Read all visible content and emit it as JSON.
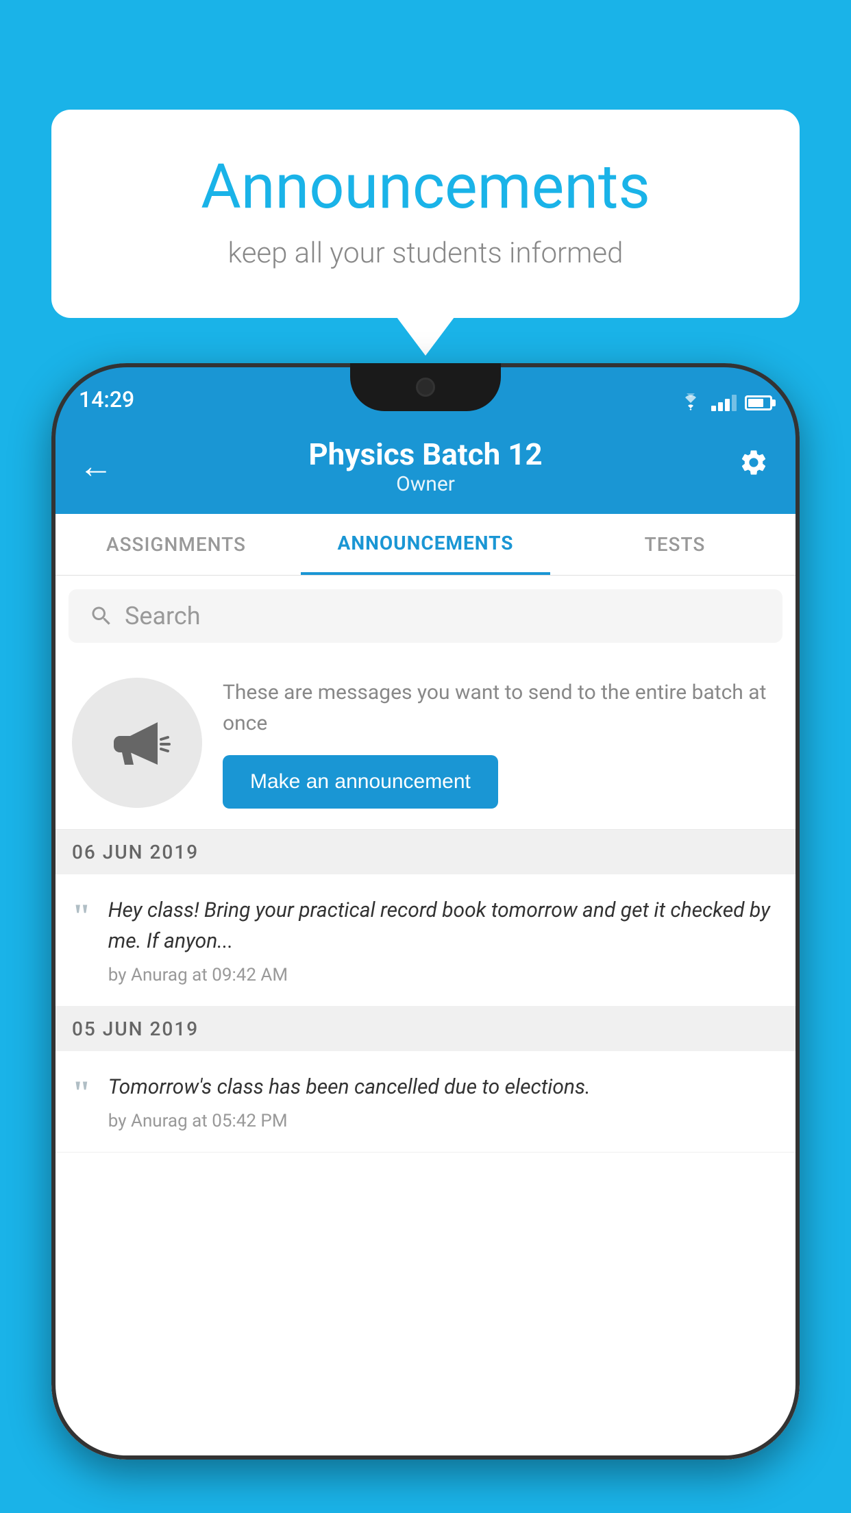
{
  "background_color": "#1ab3e8",
  "speech_bubble": {
    "title": "Announcements",
    "subtitle": "keep all your students informed"
  },
  "status_bar": {
    "time": "14:29"
  },
  "header": {
    "title": "Physics Batch 12",
    "subtitle": "Owner",
    "back_label": "←",
    "settings_label": "⚙"
  },
  "tabs": [
    {
      "label": "ASSIGNMENTS",
      "active": false
    },
    {
      "label": "ANNOUNCEMENTS",
      "active": true
    },
    {
      "label": "TESTS",
      "active": false
    }
  ],
  "search": {
    "placeholder": "Search"
  },
  "promo": {
    "description": "These are messages you want to\nsend to the entire batch at once",
    "button_label": "Make an announcement"
  },
  "announcements": [
    {
      "date": "06  JUN  2019",
      "message": "Hey class! Bring your practical record book tomorrow and get it checked by me. If anyon...",
      "meta": "by Anurag at 09:42 AM"
    },
    {
      "date": "05  JUN  2019",
      "message": "Tomorrow's class has been cancelled due to elections.",
      "meta": "by Anurag at 05:42 PM"
    }
  ]
}
